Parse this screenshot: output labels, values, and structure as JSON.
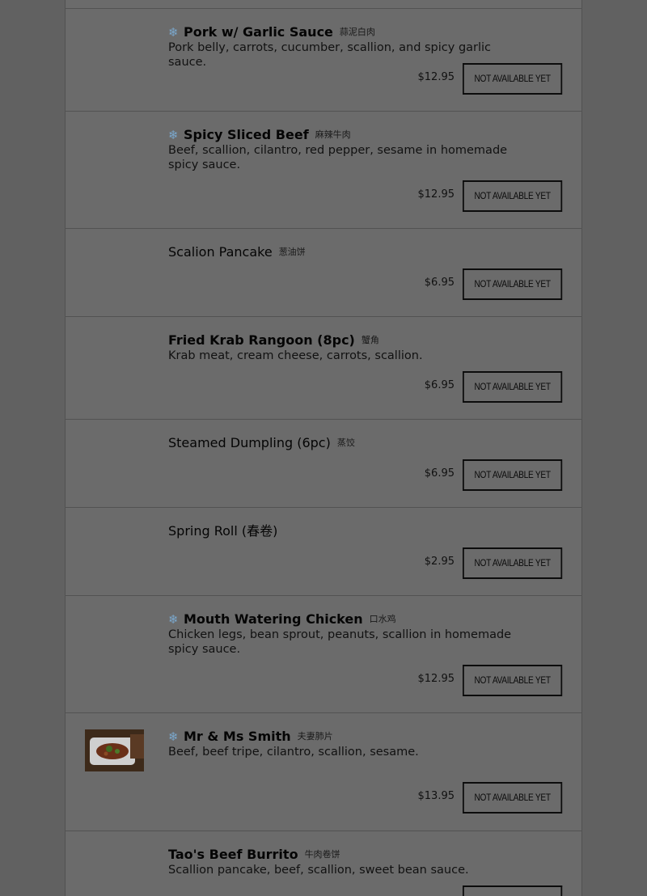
{
  "button_label": "NOT AVAILABLE YET",
  "items": [
    {
      "name": "Pork w/ Garlic Sauce",
      "chinese": "蒜泥白肉",
      "description": "Pork belly, carrots, cucumber, scallion, and spicy garlic sauce.",
      "price": "$12.95",
      "spicy": true,
      "bold": true
    },
    {
      "name": "Spicy Sliced Beef",
      "chinese": "麻辣牛肉",
      "description": "Beef, scallion, cilantro, red pepper, sesame in homemade spicy sauce.",
      "price": "$12.95",
      "spicy": true,
      "bold": true
    },
    {
      "name": "Scalion Pancake",
      "chinese": "葱油饼",
      "description": "",
      "price": "$6.95",
      "spicy": false,
      "bold": false
    },
    {
      "name": "Fried Krab Rangoon (8pc)",
      "chinese": "蟹角",
      "description": "Krab meat, cream cheese, carrots, scallion.",
      "price": "$6.95",
      "spicy": false,
      "bold": true
    },
    {
      "name": "Steamed Dumpling (6pc)",
      "chinese": "蒸饺",
      "description": "",
      "price": "$6.95",
      "spicy": false,
      "bold": false
    },
    {
      "name": "Spring Roll (春卷)",
      "chinese": "",
      "description": "",
      "price": "$2.95",
      "spicy": false,
      "bold": false
    },
    {
      "name": "Mouth Watering Chicken",
      "chinese": "口水鸡",
      "description": "Chicken legs, bean sprout, peanuts, scallion in homemade spicy sauce.",
      "price": "$12.95",
      "spicy": true,
      "bold": true
    },
    {
      "name": "Mr & Ms Smith",
      "chinese": "夫妻肺片",
      "description": "Beef, beef tripe, cilantro, scallion, sesame.",
      "price": "$13.95",
      "spicy": true,
      "bold": true
    },
    {
      "name": "Tao's Beef Burrito",
      "chinese": "牛肉卷饼",
      "description": "Scallion pancake, beef, scallion, sweet bean sauce.",
      "price": "",
      "spicy": false,
      "bold": true
    }
  ]
}
